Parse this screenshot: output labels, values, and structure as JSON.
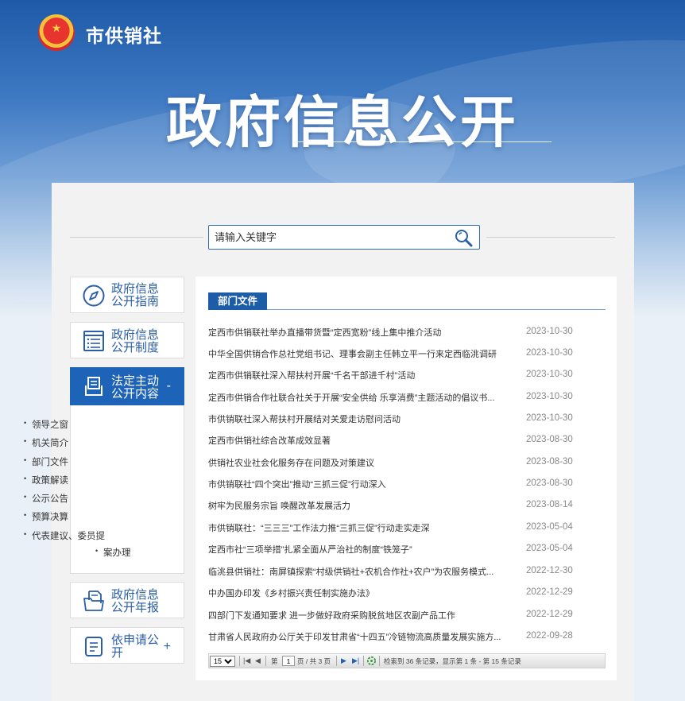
{
  "header": {
    "site_name": "市供销社",
    "hero_title": "政府信息公开"
  },
  "search": {
    "placeholder": "请输入关键字"
  },
  "nav": {
    "guide": [
      "政府信息",
      "公开指南"
    ],
    "system": [
      "政府信息",
      "公开制度"
    ],
    "active": [
      "法定主动",
      "公开内容"
    ],
    "active_sign": "-",
    "sub_items": [
      "领导之窗",
      "机关简介",
      "部门文件",
      "政策解读",
      "公示公告",
      "预算决算",
      "代表建议、委员提",
      "案办理"
    ],
    "annual": [
      "政府信息",
      "公开年报"
    ],
    "apply": [
      "依申请公",
      "开"
    ],
    "apply_sign": "+"
  },
  "section": {
    "title": "部门文件"
  },
  "articles": [
    {
      "title": "定西市供销联社举办直播带货暨“定西宽粉”线上集中推介活动",
      "date": "2023-10-30"
    },
    {
      "title": "中华全国供销合作总社党组书记、理事会副主任韩立平一行来定西临洮调研",
      "date": "2023-10-30"
    },
    {
      "title": "定西市供销联社深入帮扶村开展“千名干部进千村”活动",
      "date": "2023-10-30"
    },
    {
      "title": "定西市供销合作社联合社关于开展“安全供给 乐享消费”主题活动的倡议书...",
      "date": "2023-10-30"
    },
    {
      "title": "市供销联社深入帮扶村开展结对关爱走访慰问活动",
      "date": "2023-10-30"
    },
    {
      "title": "定西市供销社综合改革成效显著",
      "date": "2023-08-30"
    },
    {
      "title": "供销社农业社会化服务存在问题及对策建议",
      "date": "2023-08-30"
    },
    {
      "title": "市供销联社“四个突出”推动“三抓三促”行动深入",
      "date": "2023-08-30"
    },
    {
      "title": "树牢为民服务宗旨 唤醒改革发展活力",
      "date": "2023-08-14"
    },
    {
      "title": "市供销联社：“三三三”工作法力推“三抓三促”行动走实走深",
      "date": "2023-05-04"
    },
    {
      "title": "定西市社“三项举措”扎紧全面从严治社的制度“铁笼子”",
      "date": "2023-05-04"
    },
    {
      "title": "临洮县供销社：南屏镇探索“村级供销社+农机合作社+农户”为农服务模式...",
      "date": "2022-12-30"
    },
    {
      "title": "中办国办印发《乡村振兴责任制实施办法》",
      "date": "2022-12-29"
    },
    {
      "title": "四部门下发通知要求 进一步做好政府采购脱贫地区农副产品工作",
      "date": "2022-12-29"
    },
    {
      "title": "甘肃省人民政府办公厅关于印发甘肃省“十四五”冷链物流高质量发展实施方...",
      "date": "2022-09-28"
    }
  ],
  "pager": {
    "page_size": "15",
    "page_label": "第",
    "current_page": "1",
    "total_label": "页 / 共 3 页",
    "status": "检索到 36 条记录，显示第 1 条 - 第 15 条记录"
  },
  "colors": {
    "primary": "#1d63b8",
    "link_blue": "#2a5ea8"
  }
}
